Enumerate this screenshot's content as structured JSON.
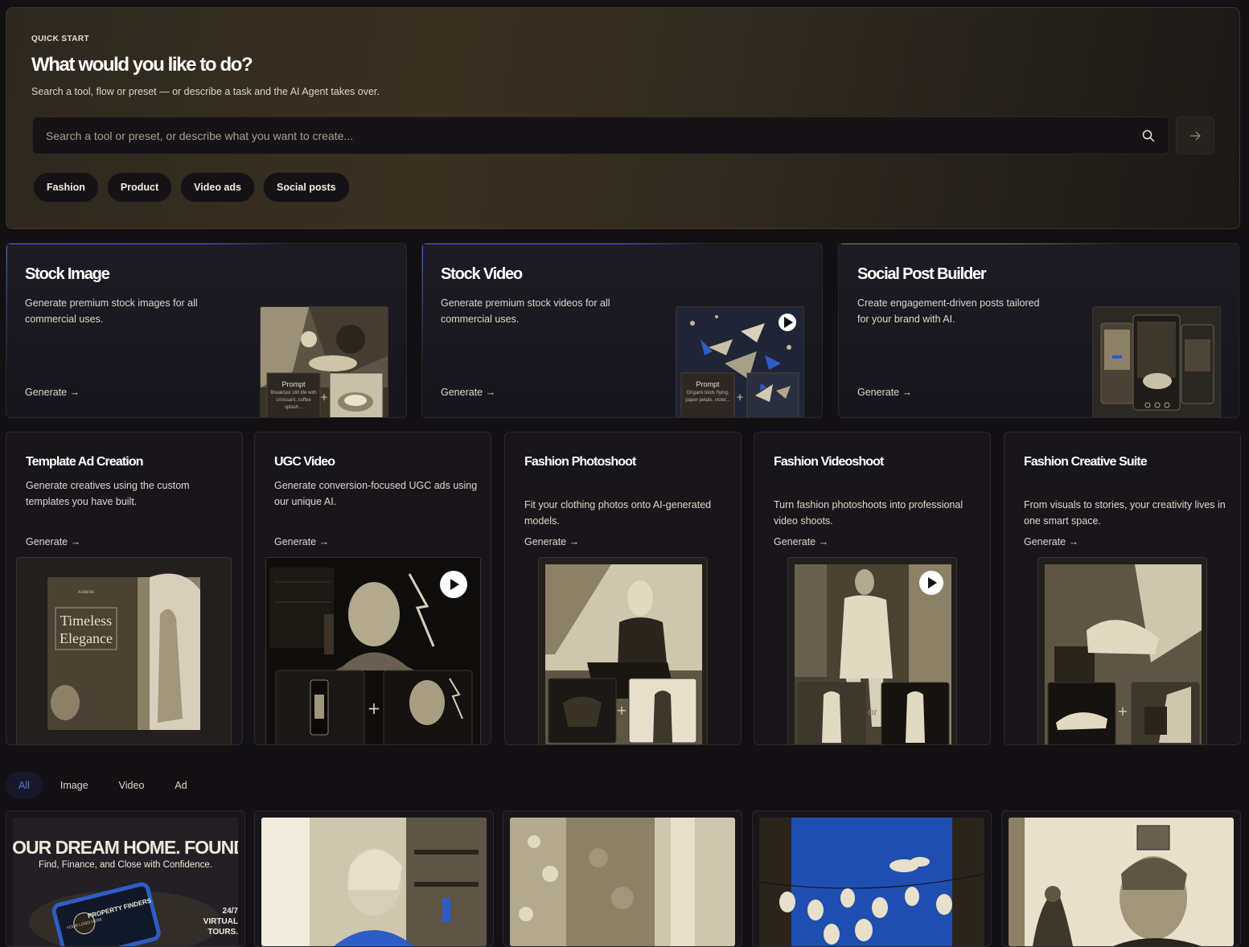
{
  "quick_start": {
    "eyebrow": "QUICK START",
    "title": "What would you like to do?",
    "subtitle": "Search a tool, flow or preset — or describe a task and the AI Agent takes over.",
    "search_placeholder": "Search a tool or preset, or describe what you want to create...",
    "search_icon": "search-icon",
    "submit_icon": "arrow-right-icon",
    "chips": [
      "Fashion",
      "Product",
      "Video ads",
      "Social posts"
    ]
  },
  "featured": [
    {
      "title": "Stock Image",
      "description": "Generate premium stock images for all commercial uses.",
      "cta": "Generate →",
      "prompt_label": "Prompt",
      "prompt_text": "Breakfast still life with croissant, coffee splash...",
      "accent": "#3b6fd4"
    },
    {
      "title": "Stock Video",
      "description": "Generate premium stock videos for all commercial uses.",
      "cta": "Generate →",
      "prompt_label": "Prompt",
      "prompt_text": "Origami birds flying, paper petals, violet...",
      "accent": "#3b6fd4"
    },
    {
      "title": "Social Post Builder",
      "description": "Create engagement-driven posts tailored for your brand with AI.",
      "cta": "Generate →",
      "accent": "#8a7450"
    }
  ],
  "tools": [
    {
      "title": "Template Ad Creation",
      "description": "Generate creatives using the custom templates you have built.",
      "cta": "Generate →",
      "template_brand": "AURENE",
      "template_title_1": "Timeless",
      "template_title_2": "Elegance"
    },
    {
      "title": "UGC Video",
      "description": "Generate conversion-focused UGC ads using our unique AI.",
      "cta": "Generate →"
    },
    {
      "title": "Fashion Photoshoot",
      "description": "Fit your clothing photos onto AI-generated models.",
      "cta": "Generate →"
    },
    {
      "title": "Fashion Videoshoot",
      "description": "Turn fashion photoshoots into professional video shoots.",
      "cta": "Generate →",
      "or_label": "or"
    },
    {
      "title": "Fashion Creative Suite",
      "description": "From visuals to stories, your creativity lives in one smart space.",
      "cta": "Generate →"
    }
  ],
  "filters": {
    "active": "All",
    "tabs": [
      "All",
      "Image",
      "Video",
      "Ad"
    ]
  },
  "gallery": {
    "ad_headline": "YOUR DREAM HOME. FOUND.",
    "ad_subline": "Find, Finance, and Close with Confidence.",
    "ad_badge": "24/7 VIRTUAL TOURS.",
    "ad_brand": "PROPERTY FINDERS",
    "ad_logo": "YOUR LOGO HERE"
  },
  "colors": {
    "background": "#121013",
    "accent_blue": "#3b6fd4",
    "hero_gold": "#3a3122"
  }
}
